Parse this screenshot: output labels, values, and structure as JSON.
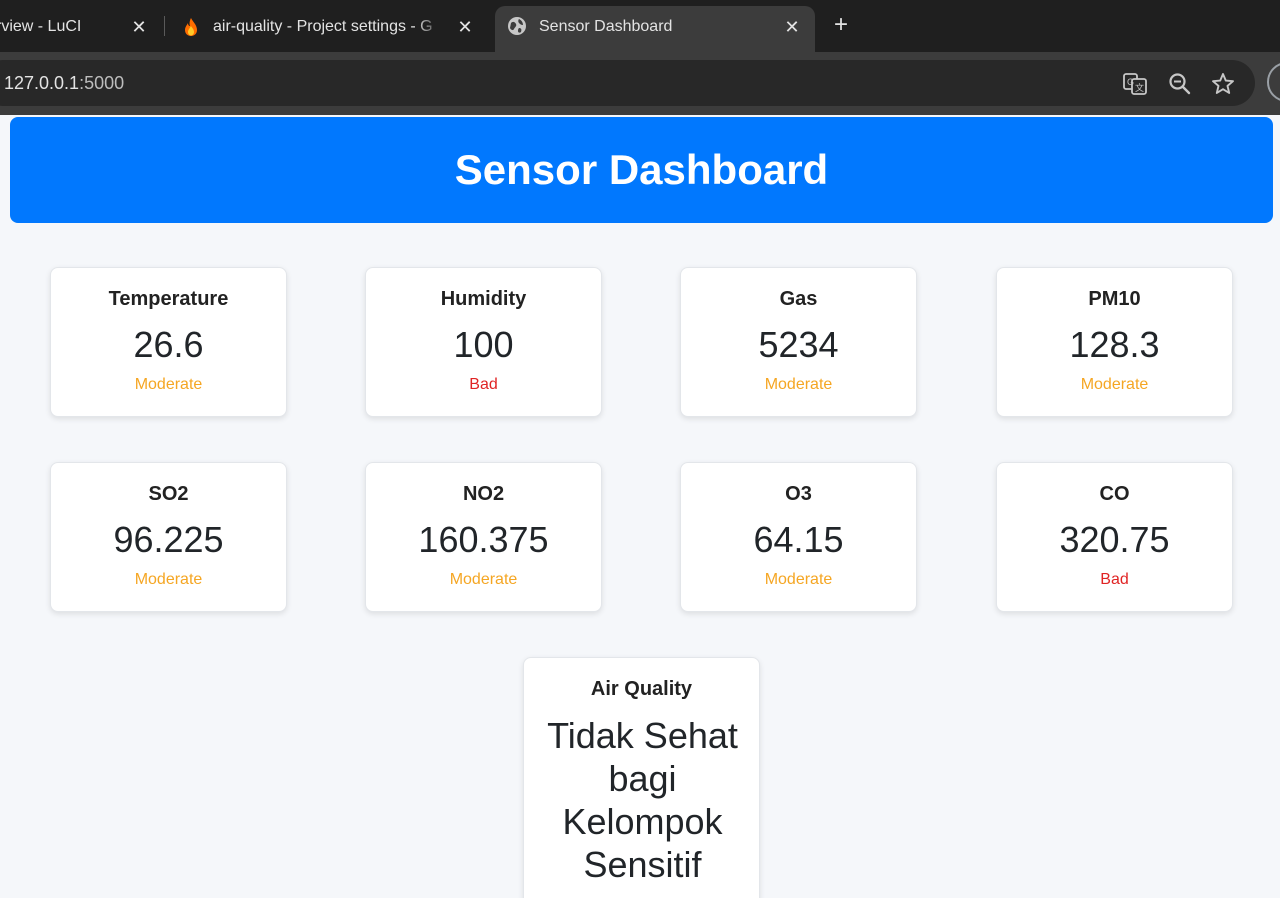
{
  "browser": {
    "tabs": [
      {
        "title": "rview - LuCI",
        "icon": "none"
      },
      {
        "title": "air-quality - Project settings - G",
        "icon": "firebase-icon"
      },
      {
        "title": "Sensor Dashboard",
        "icon": "globe-icon",
        "active": true
      }
    ],
    "close_glyph": "✕",
    "new_tab_glyph": "+",
    "url_host": "127.0.0.1",
    "url_port": ":5000",
    "toolbar_icons": [
      "translate-icon",
      "zoom-icon",
      "bookmark-star-icon"
    ]
  },
  "dashboard": {
    "title": "Sensor Dashboard",
    "sensors": [
      {
        "label": "Temperature",
        "value": "26.6",
        "status": "Moderate"
      },
      {
        "label": "Humidity",
        "value": "100",
        "status": "Bad"
      },
      {
        "label": "Gas",
        "value": "5234",
        "status": "Moderate"
      },
      {
        "label": "PM10",
        "value": "128.3",
        "status": "Moderate"
      },
      {
        "label": "SO2",
        "value": "96.225",
        "status": "Moderate"
      },
      {
        "label": "NO2",
        "value": "160.375",
        "status": "Moderate"
      },
      {
        "label": "O3",
        "value": "64.15",
        "status": "Moderate"
      },
      {
        "label": "CO",
        "value": "320.75",
        "status": "Bad"
      }
    ],
    "air_quality": {
      "label": "Air Quality",
      "value": "Tidak Sehat bagi Kelompok Sensitif"
    }
  },
  "colors": {
    "header_bg": "#0178fe",
    "moderate": "#f5a623",
    "bad": "#e02424",
    "tab_active": "#3c3c3c",
    "tabbar": "#1f1f1f"
  }
}
